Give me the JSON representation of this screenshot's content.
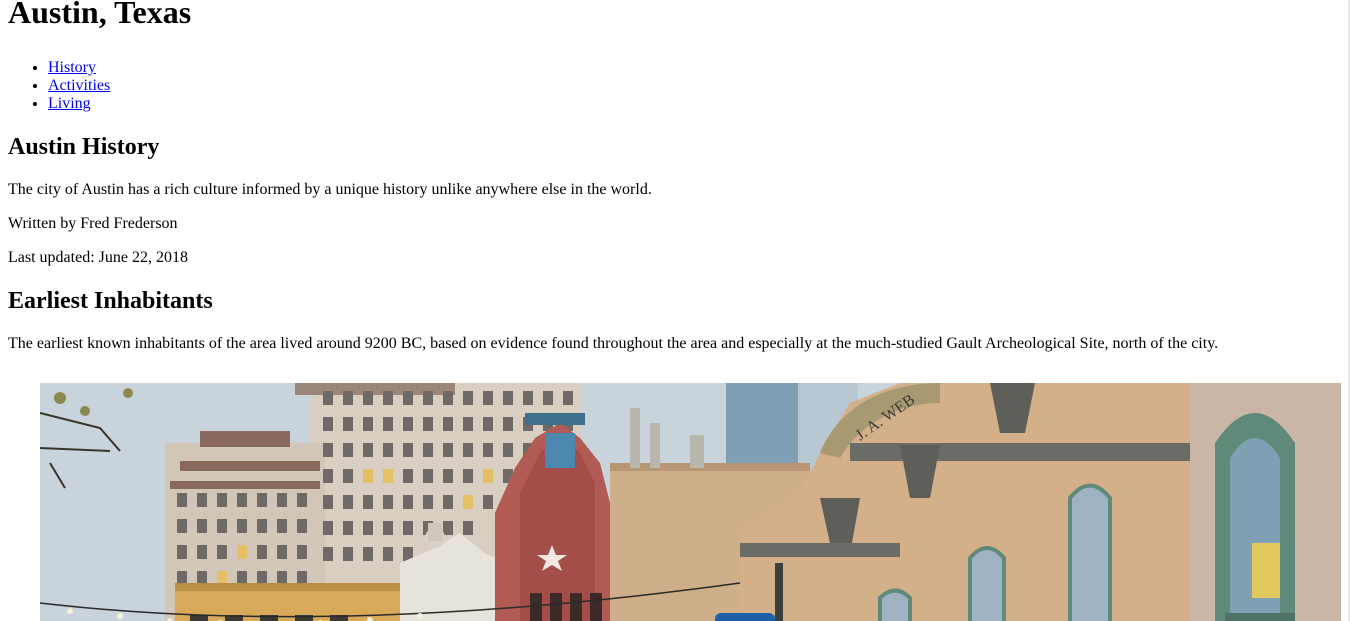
{
  "page": {
    "title": "Austin, Texas"
  },
  "nav": {
    "items": [
      {
        "label": "History"
      },
      {
        "label": "Activities"
      },
      {
        "label": "Living"
      }
    ]
  },
  "history": {
    "heading": "Austin History",
    "intro": "The city of Austin has a rich culture informed by a unique history unlike anywhere else in the world.",
    "byline": "Written by Fred Frederson",
    "updated": "Last updated: June 22, 2018"
  },
  "inhabitants": {
    "heading": "Earliest Inhabitants",
    "text": "The earliest known inhabitants of the area lived around 9200 BC, based on evidence found throughout the area and especially at the much-studied Gault Archeological Site, north of the city."
  },
  "hero": {
    "sign_text": "J. A. WEB",
    "colors": {
      "sky": "#c9d3db",
      "tower": "#d8cfc2",
      "red_facade": "#b25b55",
      "brick": "#cfae8a",
      "right_wall": "#c9b6a6",
      "window_trim": "#5f8a7a"
    }
  }
}
